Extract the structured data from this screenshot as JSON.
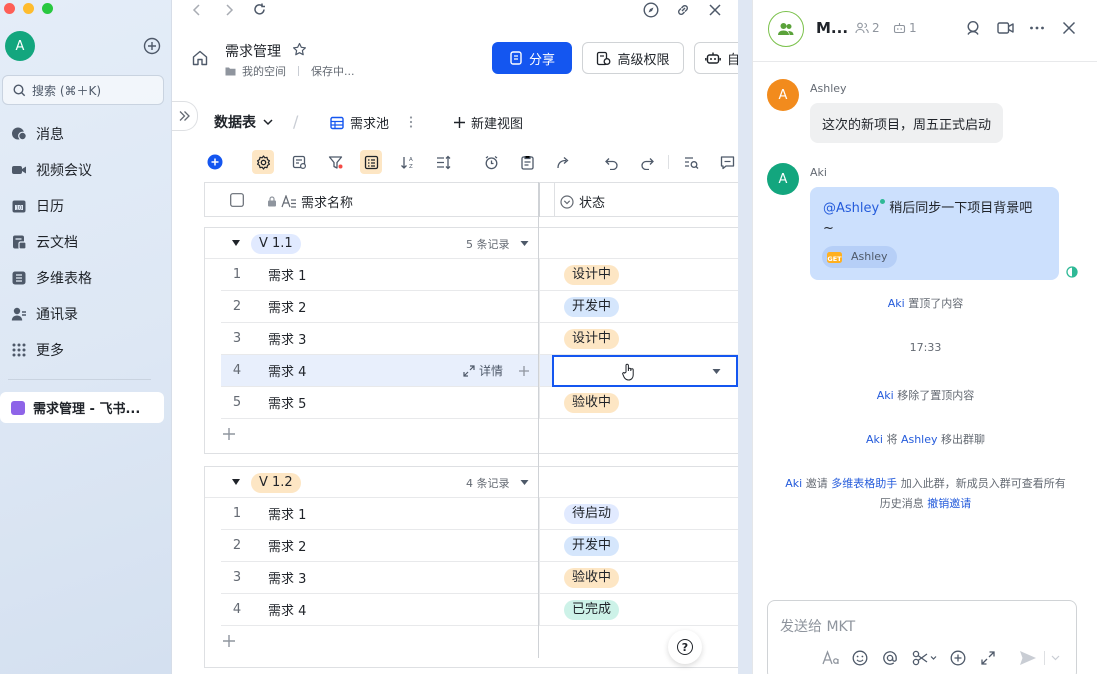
{
  "sidebar": {
    "avatar_letter": "A",
    "search_placeholder": "搜索 (⌘＋K)",
    "nav": [
      {
        "label": "消息",
        "icon": "message-icon"
      },
      {
        "label": "视频会议",
        "icon": "video-icon"
      },
      {
        "label": "日历",
        "icon": "calendar-icon"
      },
      {
        "label": "云文档",
        "icon": "cloud-doc-icon"
      },
      {
        "label": "多维表格",
        "icon": "base-icon"
      },
      {
        "label": "通讯录",
        "icon": "contacts-icon"
      },
      {
        "label": "更多",
        "icon": "more-grid-icon"
      }
    ],
    "open_doc": "需求管理 - 飞书..."
  },
  "doc": {
    "title": "需求管理",
    "space": "我的空间",
    "save_status": "保存中...",
    "share_label": "分享",
    "permission_label": "高级权限",
    "auto_label": "自"
  },
  "view_bar": {
    "table_label": "数据表",
    "view_name": "需求池",
    "new_view_label": "新建视图"
  },
  "grid": {
    "col_name": "需求名称",
    "col_status": "状态",
    "detail_label": "详情",
    "groups": [
      {
        "label": "V 1.1",
        "count_label": "5 条记录",
        "rows": [
          {
            "num": "1",
            "name": "需求 1",
            "status": "设计中"
          },
          {
            "num": "2",
            "name": "需求 2",
            "status": "开发中"
          },
          {
            "num": "3",
            "name": "需求 3",
            "status": "设计中"
          },
          {
            "num": "4",
            "name": "需求 4",
            "status": ""
          },
          {
            "num": "5",
            "name": "需求 5",
            "status": "验收中"
          }
        ]
      },
      {
        "label": "V 1.2",
        "count_label": "4 条记录",
        "rows": [
          {
            "num": "1",
            "name": "需求 1",
            "status": "待启动"
          },
          {
            "num": "2",
            "name": "需求 2",
            "status": "开发中"
          },
          {
            "num": "3",
            "name": "需求 3",
            "status": "验收中"
          },
          {
            "num": "4",
            "name": "需求 4",
            "status": "已完成"
          }
        ]
      }
    ],
    "help": "?"
  },
  "status_colors": {
    "设计中": {
      "bg": "#fde6c4",
      "fg": "#1f2329"
    },
    "开发中": {
      "bg": "#d5e6fc",
      "fg": "#1f2329"
    },
    "验收中": {
      "bg": "#fde6c4",
      "fg": "#1f2329"
    },
    "待启动": {
      "bg": "#e1eaff",
      "fg": "#1f2329"
    },
    "已完成": {
      "bg": "#cdf2e8",
      "fg": "#1f2329"
    }
  },
  "chat": {
    "title": "M...",
    "member_count": "2",
    "bot_count": "1",
    "messages": [
      {
        "sender": "Ashley",
        "avatar": "A",
        "text": "这次的新项目，周五正式启动"
      },
      {
        "sender": "Aki",
        "avatar": "A",
        "mention": "@Ashley",
        "text": "稍后同步一下项目背景吧 ~",
        "reaction_user": "Ashley"
      }
    ],
    "sys1_name": "Aki",
    "sys1_text": "置顶了内容",
    "time": "17:33",
    "sys2_name": "Aki",
    "sys2_text": "移除了置顶内容",
    "sys3_name": "Aki",
    "sys3_mid": "将",
    "sys3_target": "Ashley",
    "sys3_text": "移出群聊",
    "sys4_name": "Aki",
    "sys4_mid": "邀请",
    "sys4_bot": "多维表格助手",
    "sys4_text": "加入此群，新成员入群可查看所有",
    "sys4_line2": "历史消息",
    "sys4_revoke": "撤销邀请",
    "composer_placeholder": "发送给 MKT"
  },
  "colors": {
    "accent": "#1456f0",
    "link": "#245bdb",
    "ashley_avatar": "#f28b1d",
    "aki_avatar": "#13a67e"
  }
}
